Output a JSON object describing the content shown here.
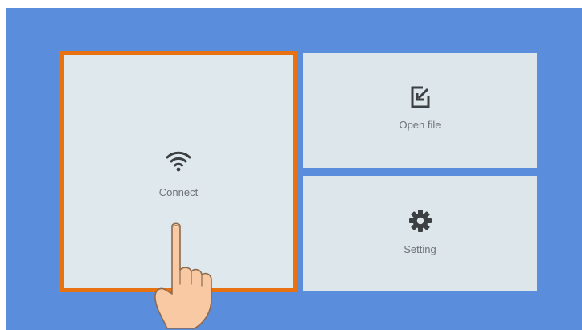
{
  "tiles": {
    "connect": {
      "label": "Connect",
      "icon": "wifi-icon",
      "selected": true
    },
    "open_file": {
      "label": "Open file",
      "icon": "open-file-icon"
    },
    "setting": {
      "label": "Setting",
      "icon": "gear-icon"
    }
  },
  "colors": {
    "background": "#5b8ddd",
    "tile": "#dde6ea",
    "selection_border": "#e87211",
    "icon": "#3c4043",
    "label": "#6e7478",
    "hand_skin": "#f8c9a3",
    "hand_outline": "#8c6a4f"
  },
  "overlay": {
    "pointer": "tap-hand-icon"
  }
}
